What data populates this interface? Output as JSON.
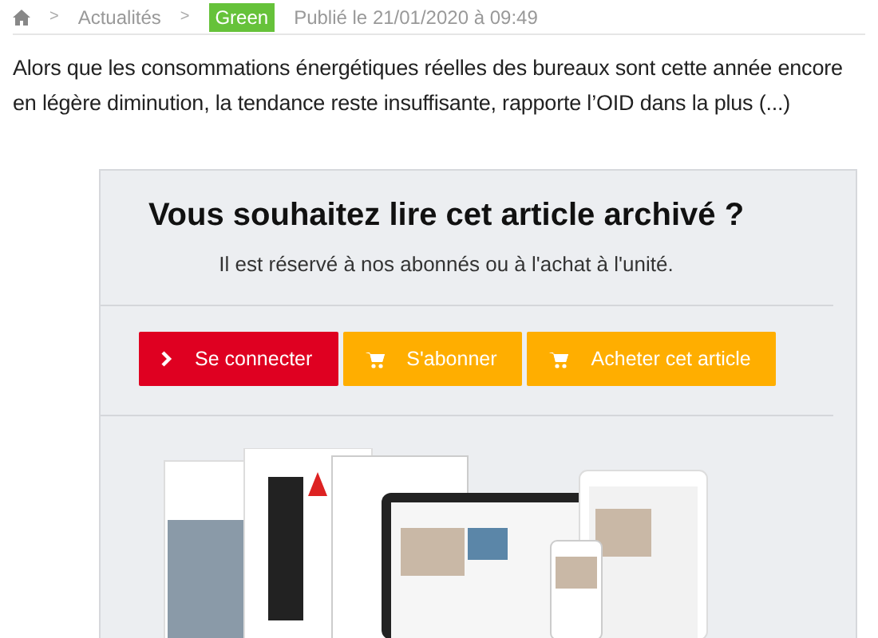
{
  "breadcrumb": {
    "items": [
      {
        "kind": "home"
      },
      {
        "kind": "link",
        "label": "Actualités"
      },
      {
        "kind": "tag",
        "label": "Green"
      }
    ],
    "separator": ">",
    "date": "Publié le 21/01/2020 à 09:49"
  },
  "excerpt": "Alors que les consommations énergétiques réelles des bureaux sont cette année encore en légère diminution, la tendance reste insuffisante, rapporte l’OID dans la plus (...)",
  "paywall": {
    "title": "Vous souhaitez lire cet article archivé ?",
    "subtitle": "Il est réservé à nos abonnés ou à l'achat à l'unité.",
    "buttons": [
      {
        "kind": "login",
        "label": "Se connecter"
      },
      {
        "kind": "cart",
        "label": "S'abonner"
      },
      {
        "kind": "cart",
        "label": "Acheter cet article"
      }
    ]
  }
}
